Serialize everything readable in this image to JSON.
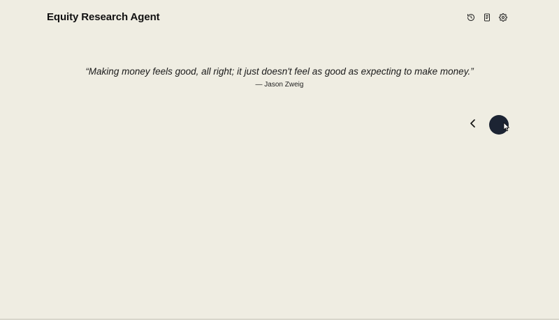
{
  "app": {
    "title": "Equity Research Agent"
  },
  "toolbar": {
    "buttons": [
      {
        "icon": "history-icon"
      },
      {
        "icon": "notebook-icon"
      },
      {
        "icon": "gear-icon"
      }
    ]
  },
  "quote": {
    "text": "“Making money feels good, all right; it just doesn't feel as good as expecting to make money.”",
    "author": "— Jason Zweig"
  },
  "navigation": {
    "back_icon": "chevron-left-icon",
    "primary_button_color": "#1c2433"
  },
  "colors": {
    "background": "#efede2",
    "text": "#111111",
    "accent": "#1c2433"
  }
}
